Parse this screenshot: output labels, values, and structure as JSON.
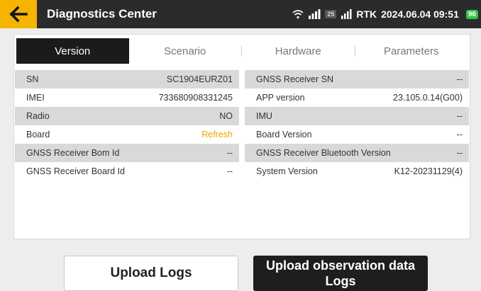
{
  "header": {
    "title": "Diagnostics Center",
    "status": {
      "signal_badge": "25",
      "rtk": "RTK",
      "datetime": "2024.06.04 09:51",
      "battery": "96"
    }
  },
  "tabs": [
    {
      "label": "Version",
      "active": true
    },
    {
      "label": "Scenario",
      "active": false
    },
    {
      "label": "Hardware",
      "active": false
    },
    {
      "label": "Parameters",
      "active": false
    }
  ],
  "left_rows": [
    {
      "label": "SN",
      "value": "SC1904EURZ01"
    },
    {
      "label": "IMEI",
      "value": "733680908331245"
    },
    {
      "label": "Radio",
      "value": "NO"
    },
    {
      "label": "Board",
      "value": "Refresh"
    },
    {
      "label": "GNSS Receiver Bom Id",
      "value": "--"
    },
    {
      "label": "GNSS Receiver Board Id",
      "value": "--"
    }
  ],
  "right_rows": [
    {
      "label": "GNSS Receiver SN",
      "value": "--"
    },
    {
      "label": "APP version",
      "value": "23.105.0.14(G00)"
    },
    {
      "label": "IMU",
      "value": "--"
    },
    {
      "label": "Board Version",
      "value": "--"
    },
    {
      "label": "GNSS Receiver Bluetooth Version",
      "value": "--"
    },
    {
      "label": "System Version",
      "value": "K12-20231129(4)"
    }
  ],
  "buttons": {
    "upload_logs": "Upload Logs",
    "upload_obs_logs": "Upload observation data Logs"
  },
  "colors": {
    "accent": "#f4b400",
    "topbar": "#2b2b2b",
    "refresh": "#f0a500"
  }
}
